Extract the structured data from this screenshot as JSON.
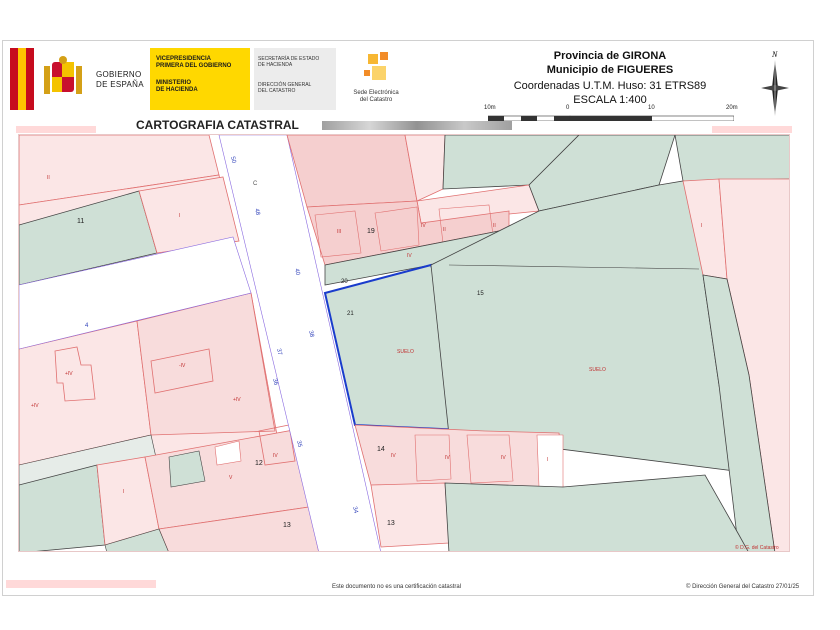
{
  "header": {
    "gobierno": [
      "GOBIERNO",
      "DE ESPAÑA"
    ],
    "vicepresidencia": [
      "VICEPRESIDENCIA",
      "PRIMERA DEL GOBIERNO",
      "",
      "MINISTERIO",
      "DE HACIENDA"
    ],
    "secretaria": [
      "SECRETARÍA DE ESTADO",
      "DE HACIENDA",
      "",
      "DIRECCIÓN GENERAL",
      "DEL CATASTRO"
    ],
    "sede": [
      "Sede Electrónica",
      "del Catastro"
    ],
    "provincia": "Provincia de GIRONA",
    "municipio": "Municipio de FIGUERES",
    "coordenadas": "Coordenadas U.T.M. Huso: 31 ETRS89",
    "escala": "ESCALA 1:400",
    "scale_labels": [
      "10m",
      "0",
      "10",
      "20m"
    ],
    "north": "N"
  },
  "title": "CARTOGRAFIA CATASTRAL",
  "footer": {
    "center": "Este documento no es una certificación catastral",
    "right": "© Dirección General del Catastro 27/01/25",
    "map_credit": "© D.G. del Catastro"
  },
  "map": {
    "parcel_numbers": [
      "11",
      "19",
      "20",
      "21",
      "15",
      "12",
      "14",
      "13",
      "13"
    ],
    "street_numbers": [
      "50",
      "48",
      "40",
      "38",
      "37",
      "36",
      "35",
      "34"
    ],
    "letters": [
      "C",
      "4"
    ],
    "unit_labels": [
      "II",
      "I",
      "III",
      "IV",
      "II",
      "IV",
      "II",
      "SUELO",
      "SUELO",
      "+IV",
      "-IV",
      "+IV",
      "+IV",
      "IV",
      "V",
      "I",
      "IV",
      "IV",
      "IV",
      "I",
      "I"
    ],
    "colors": {
      "green": "#cfe0d6",
      "pink": "#fbe6e6",
      "pink_strong": "#f5cfcf",
      "outline": "#e07070",
      "selected": "#1a3ccc",
      "street_line": "#8a6ae0"
    }
  }
}
